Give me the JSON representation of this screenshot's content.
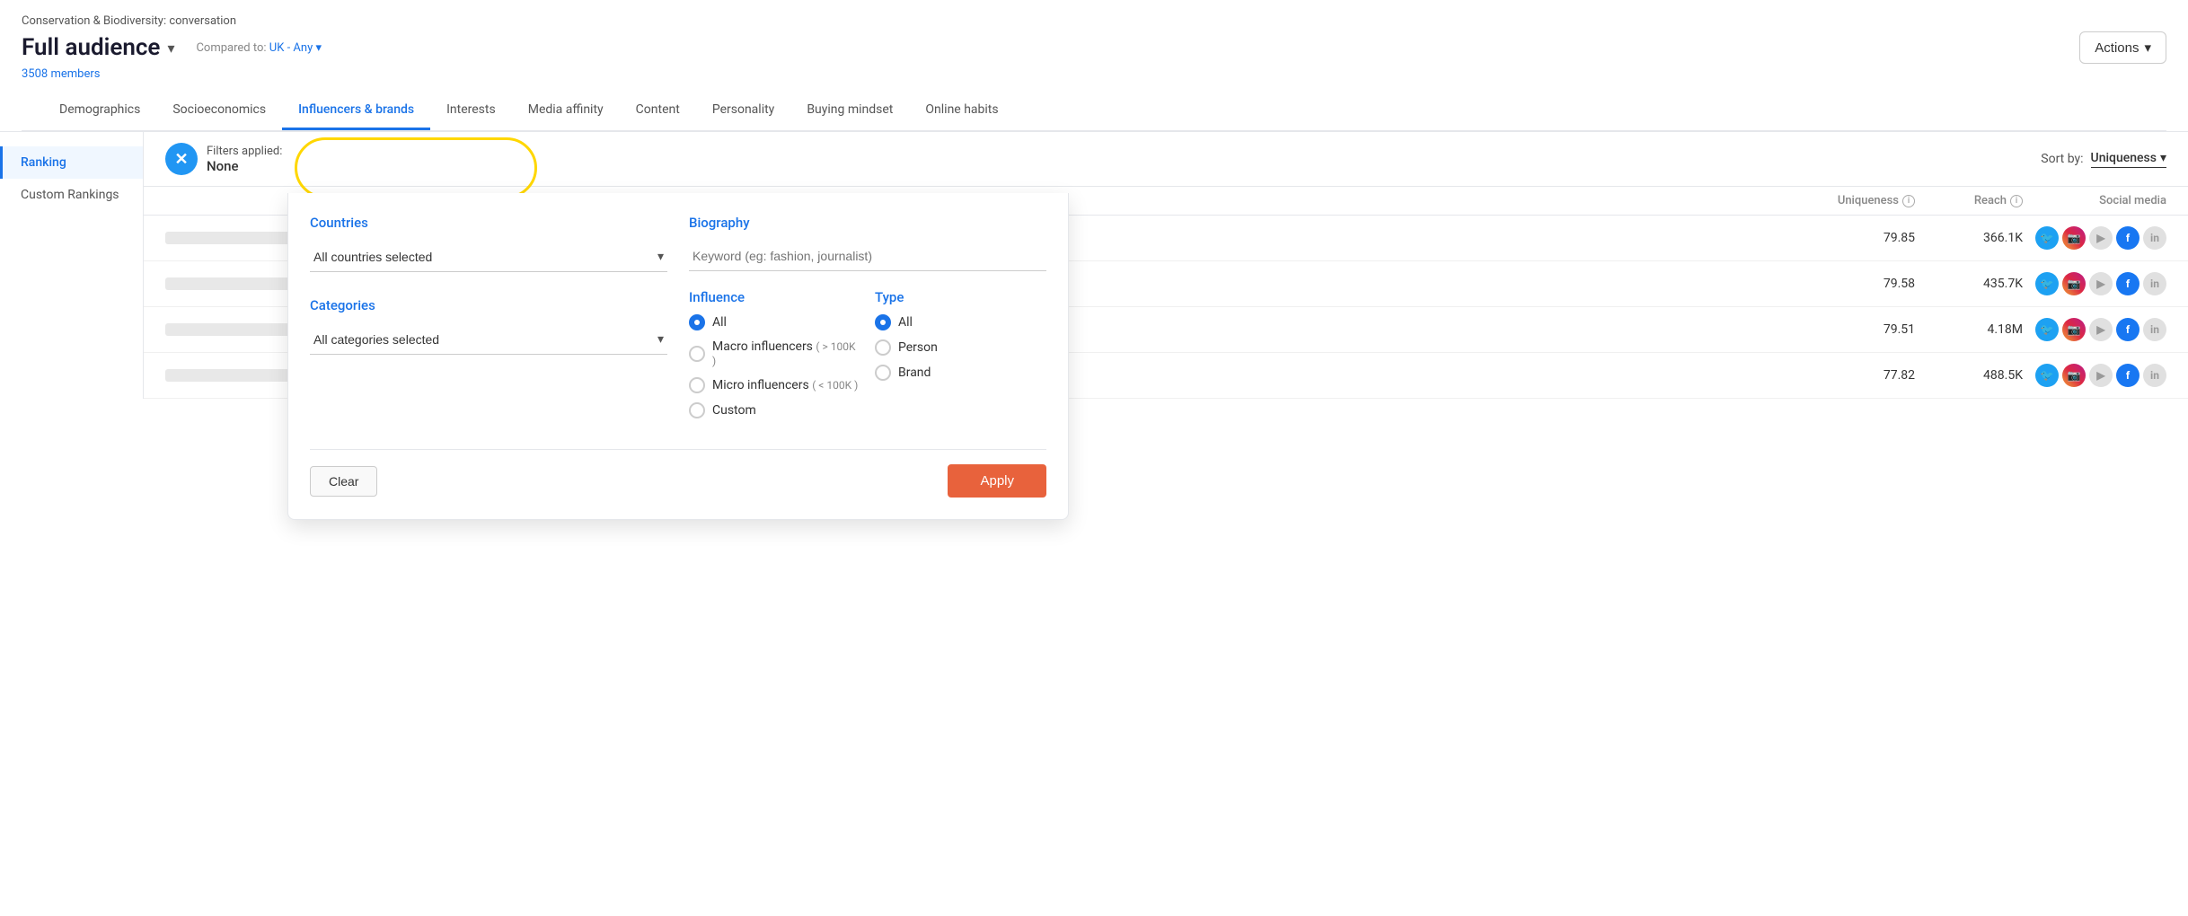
{
  "header": {
    "breadcrumb": "Conservation & Biodiversity: conversation",
    "title": "Full audience",
    "title_arrow": "▾",
    "compared_to_label": "Compared to:",
    "compared_to_value": "UK - Any",
    "compared_to_arrow": "▾",
    "members_count": "3508 members",
    "actions_label": "Actions",
    "actions_arrow": "▾"
  },
  "nav_tabs": [
    {
      "id": "demographics",
      "label": "Demographics",
      "active": false
    },
    {
      "id": "socioeconomics",
      "label": "Socioeconomics",
      "active": false
    },
    {
      "id": "influencers",
      "label": "Influencers & brands",
      "active": true
    },
    {
      "id": "interests",
      "label": "Interests",
      "active": false
    },
    {
      "id": "media-affinity",
      "label": "Media affinity",
      "active": false
    },
    {
      "id": "content",
      "label": "Content",
      "active": false
    },
    {
      "id": "personality",
      "label": "Personality",
      "active": false
    },
    {
      "id": "buying-mindset",
      "label": "Buying mindset",
      "active": false
    },
    {
      "id": "online-habits",
      "label": "Online habits",
      "active": false
    }
  ],
  "sidebar": {
    "items": [
      {
        "id": "ranking",
        "label": "Ranking",
        "active": true
      },
      {
        "id": "custom-rankings",
        "label": "Custom Rankings",
        "active": false
      }
    ]
  },
  "filter_bar": {
    "filters_applied_label": "Filters applied:",
    "filters_applied_value": "None",
    "sort_by_label": "Sort by:",
    "sort_by_value": "Uniqueness",
    "sort_by_arrow": "▾"
  },
  "table_headers": {
    "uniqueness": "Uniqueness",
    "reach": "Reach",
    "social_media": "Social media"
  },
  "table_rows": [
    {
      "uniqueness": "79.85",
      "reach": "366.1K",
      "socials": [
        "twitter",
        "instagram",
        "youtube",
        "facebook",
        "linkedin"
      ]
    },
    {
      "uniqueness": "79.58",
      "reach": "435.7K",
      "socials": [
        "twitter",
        "instagram",
        "youtube",
        "facebook",
        "linkedin"
      ]
    },
    {
      "uniqueness": "79.51",
      "reach": "4.18M",
      "socials": [
        "twitter",
        "instagram",
        "youtube",
        "facebook",
        "linkedin"
      ]
    },
    {
      "uniqueness": "77.82",
      "reach": "488.5K",
      "socials": [
        "twitter",
        "instagram",
        "youtube",
        "facebook",
        "linkedin"
      ]
    }
  ],
  "filter_panel": {
    "countries_title": "Countries",
    "countries_value": "All countries selected",
    "countries_arrow": "▾",
    "categories_title": "Categories",
    "categories_value": "All categories selected",
    "categories_arrow": "▾",
    "biography_title": "Biography",
    "biography_placeholder": "Keyword (eg: fashion, journalist)",
    "influence_title": "Influence",
    "influence_options": [
      {
        "id": "all",
        "label": "All",
        "selected": true,
        "sub": ""
      },
      {
        "id": "macro",
        "label": "Macro influencers",
        "selected": false,
        "sub": "( > 100K )"
      },
      {
        "id": "micro",
        "label": "Micro influencers",
        "selected": false,
        "sub": "( < 100K )"
      },
      {
        "id": "custom",
        "label": "Custom",
        "selected": false,
        "sub": ""
      }
    ],
    "type_title": "Type",
    "type_options": [
      {
        "id": "all",
        "label": "All",
        "selected": true,
        "sub": ""
      },
      {
        "id": "person",
        "label": "Person",
        "selected": false,
        "sub": ""
      },
      {
        "id": "brand",
        "label": "Brand",
        "selected": false,
        "sub": ""
      }
    ],
    "clear_label": "Clear",
    "apply_label": "Apply"
  }
}
